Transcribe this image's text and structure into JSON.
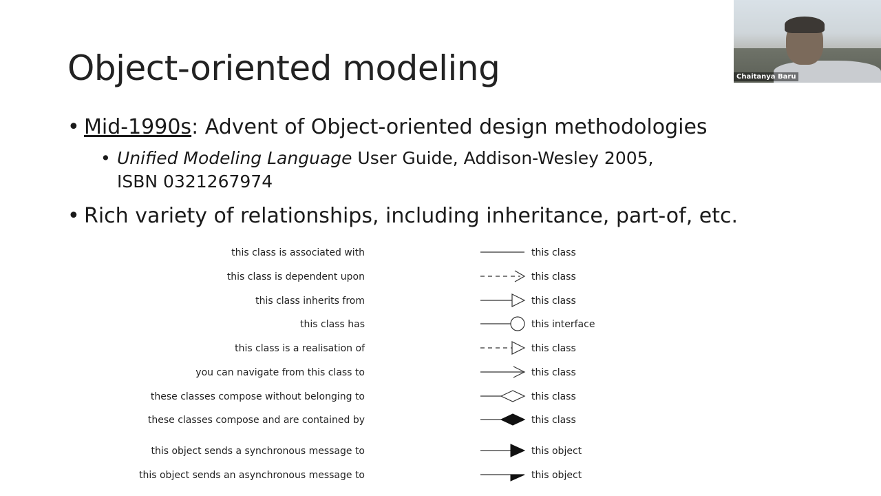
{
  "slide": {
    "title": "Object-oriented modeling",
    "bullets": [
      {
        "underlined_prefix": "Mid-1990s",
        "text": ": Advent of Object-oriented design methodologies"
      },
      {
        "text": "Rich variety of relationships, including inheritance, part-of, etc."
      }
    ],
    "sub_bullet": {
      "italic": "Unified Modeling Language",
      "rest": " User Guide, Addison-Wesley 2005,",
      "line2": "ISBN 0321267974"
    },
    "bullet_glyph": "•",
    "relationships": [
      {
        "left": "this class is associated with",
        "symbol": "association",
        "right": "this class"
      },
      {
        "left": "this class is dependent upon",
        "symbol": "dependency",
        "right": "this class"
      },
      {
        "left": "this class inherits from",
        "symbol": "inheritance",
        "right": "this class"
      },
      {
        "left": "this class has",
        "symbol": "interface-lollipop",
        "right": "this interface"
      },
      {
        "left": "this class is a realisation of",
        "symbol": "realisation",
        "right": "this class"
      },
      {
        "left": "you can navigate from this class to",
        "symbol": "navigation",
        "right": "this class"
      },
      {
        "left": "these classes compose without belonging to",
        "symbol": "aggregation",
        "right": "this class"
      },
      {
        "left": "these classes compose and are contained by",
        "symbol": "composition",
        "right": "this class"
      },
      {
        "left": "this object sends a synchronous message to",
        "symbol": "sync-message",
        "right": "this object"
      },
      {
        "left": "this object sends an asynchronous message to",
        "symbol": "async-message",
        "right": "this object"
      }
    ]
  },
  "video_participant": {
    "name": "Chaitanya Baru"
  }
}
